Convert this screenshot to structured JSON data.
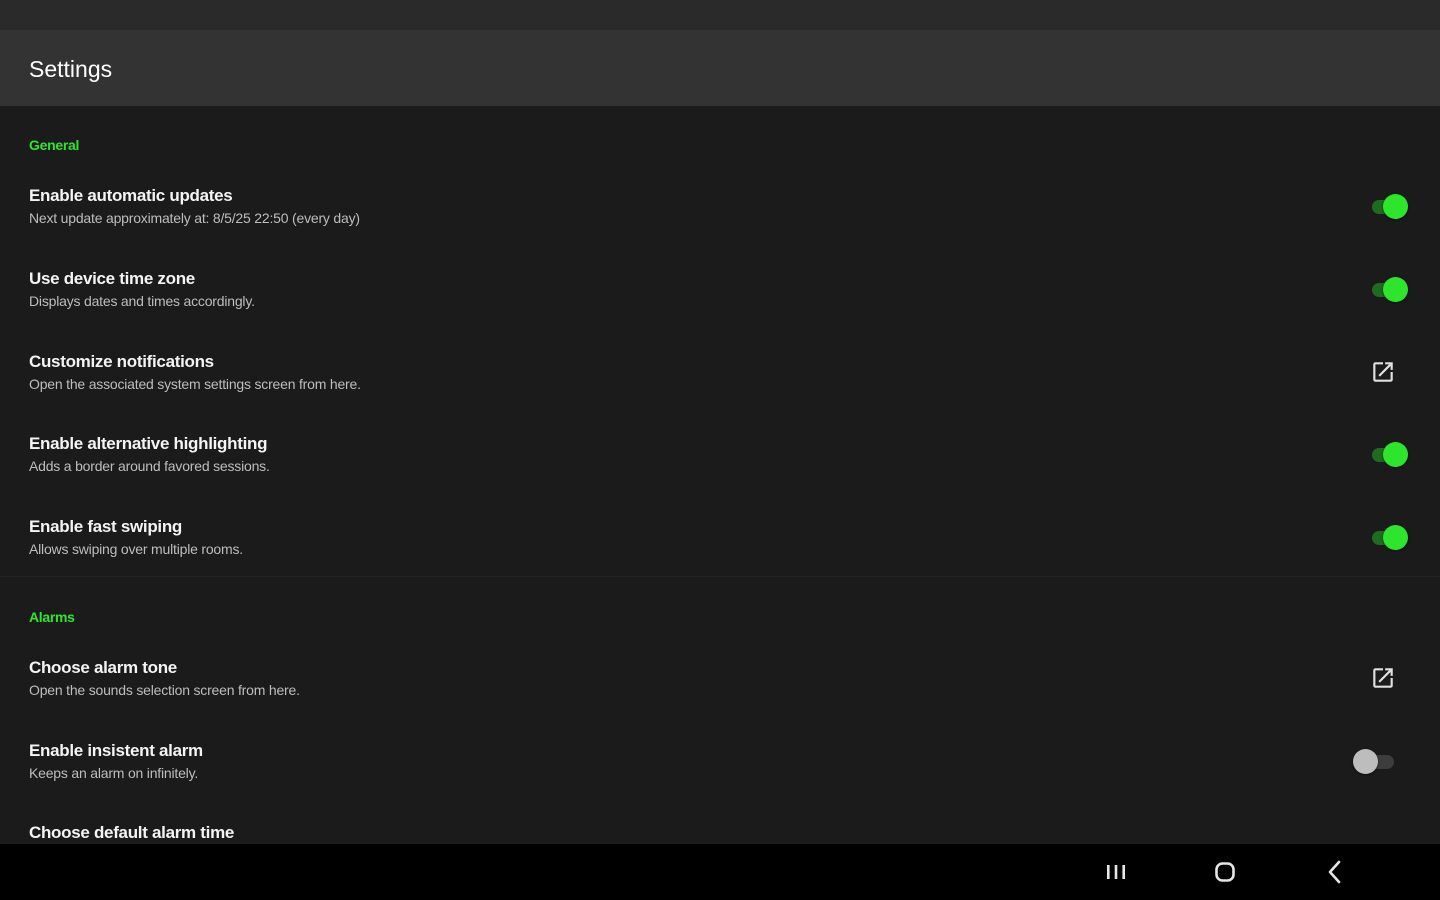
{
  "app_bar": {
    "title": "Settings"
  },
  "sections": {
    "general": {
      "header": "General",
      "items": [
        {
          "title": "Enable automatic updates",
          "summary": "Next update approximately at: 8/5/25 22:50 (every day)",
          "control": "switch",
          "checked": true
        },
        {
          "title": "Use device time zone",
          "summary": "Displays dates and times accordingly.",
          "control": "switch",
          "checked": true
        },
        {
          "title": "Customize notifications",
          "summary": "Open the associated system settings screen from here.",
          "control": "open-in-new-icon"
        },
        {
          "title": "Enable alternative highlighting",
          "summary": "Adds a border around favored sessions.",
          "control": "switch",
          "checked": true
        },
        {
          "title": "Enable fast swiping",
          "summary": "Allows swiping over multiple rooms.",
          "control": "switch",
          "checked": true
        }
      ]
    },
    "alarms": {
      "header": "Alarms",
      "items": [
        {
          "title": "Choose alarm tone",
          "summary": "Open the sounds selection screen from here.",
          "control": "open-in-new-icon"
        },
        {
          "title": "Enable insistent alarm",
          "summary": "Keeps an alarm on infinitely.",
          "control": "switch",
          "checked": false
        },
        {
          "title": "Choose default alarm time",
          "summary": ""
        }
      ]
    }
  },
  "colors": {
    "accent": "#2ee52e",
    "background": "#1b1b1b",
    "app_bar": "#333333",
    "status_bar": "#2a2a2a",
    "nav_bar": "#000000"
  },
  "nav_bar": {
    "buttons": [
      "recent-apps-icon",
      "home-icon",
      "back-icon"
    ]
  }
}
